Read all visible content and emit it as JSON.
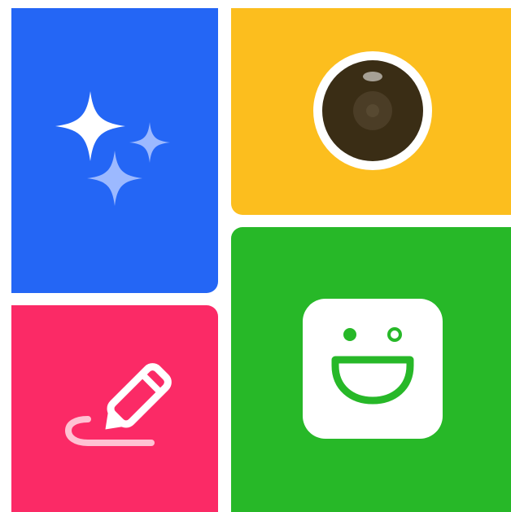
{
  "app_icon": {
    "tiles": [
      {
        "name": "sparkles",
        "color": "#2466F5"
      },
      {
        "name": "camera-lens",
        "color": "#FCBE1E"
      },
      {
        "name": "pencil-signature",
        "color": "#FB2A66"
      },
      {
        "name": "smiley-face",
        "color": "#27B828"
      }
    ],
    "colors": {
      "sparkle_primary": "#FFFFFF",
      "sparkle_secondary": "#9CB9FF",
      "lens_ring": "#FFFFFF",
      "lens_body": "#3A2D15",
      "smiley_bg": "#FFFFFF",
      "smiley_stroke": "#27B828",
      "pencil": "#FFFFFF",
      "pencil_line": "#FFC2D3"
    }
  }
}
